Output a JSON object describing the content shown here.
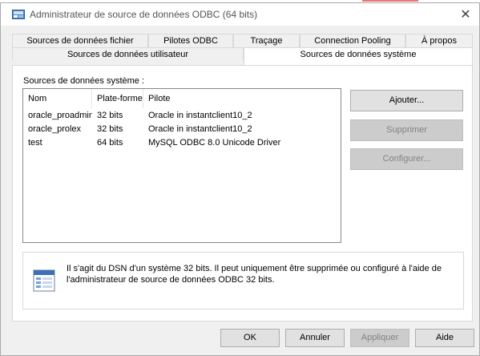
{
  "window": {
    "title": "Administrateur de source de données ODBC (64 bits)",
    "close_glyph": "✕"
  },
  "tabs": {
    "row1": [
      "Sources de données fichier",
      "Pilotes ODBC",
      "Traçage",
      "Connection Pooling",
      "À propos"
    ],
    "row2": [
      "Sources de données utilisateur",
      "Sources de données système"
    ],
    "active": "Sources de données système"
  },
  "panel": {
    "section_label": "Sources de données système :",
    "columns": [
      "Nom",
      "Plate-forme",
      "Pilote"
    ],
    "rows": [
      [
        "oracle_proadmin",
        "32 bits",
        "Oracle in instantclient10_2"
      ],
      [
        "oracle_prolex",
        "32 bits",
        "Oracle in instantclient10_2"
      ],
      [
        "test",
        "64 bits",
        "MySQL ODBC 8.0 Unicode Driver"
      ]
    ],
    "buttons": {
      "add": "Ajouter...",
      "remove": "Supprimer",
      "configure": "Configurer..."
    },
    "info_text": "Il s'agit du DSN d'un système 32 bits. Il peut uniquement être supprimée ou configuré à l'aide de l'administrateur de source de données ODBC 32 bits."
  },
  "footer": {
    "ok": "OK",
    "cancel": "Annuler",
    "apply": "Appliquer",
    "help": "Aide"
  },
  "icons": {
    "app": "odbc-admin-icon",
    "info": "data-sheet-icon",
    "close": "close-icon"
  }
}
